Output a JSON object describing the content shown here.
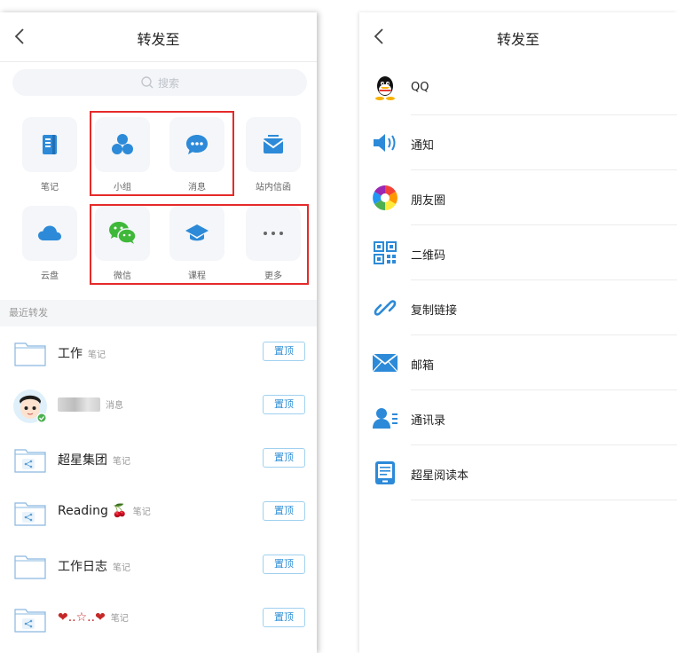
{
  "left": {
    "title": "转发至",
    "search_placeholder": "搜索",
    "tiles": [
      {
        "label": "笔记",
        "icon": "note-icon"
      },
      {
        "label": "小组",
        "icon": "group-icon"
      },
      {
        "label": "消息",
        "icon": "message-icon"
      },
      {
        "label": "站内信函",
        "icon": "letter-icon"
      },
      {
        "label": "云盘",
        "icon": "cloud-icon"
      },
      {
        "label": "微信",
        "icon": "wechat-icon"
      },
      {
        "label": "课程",
        "icon": "course-icon"
      },
      {
        "label": "更多",
        "icon": "more-icon"
      }
    ],
    "recent_header": "最近转发",
    "recent": [
      {
        "name": "工作",
        "type": "笔记",
        "pin": "置顶",
        "icon": "folder-icon"
      },
      {
        "name": "",
        "type": "消息",
        "pin": "置顶",
        "icon": "avatar"
      },
      {
        "name": "超星集团",
        "type": "笔记",
        "pin": "置顶",
        "icon": "shared-folder-icon"
      },
      {
        "name": "Reading 🍒",
        "type": "笔记",
        "pin": "置顶",
        "icon": "shared-folder-icon"
      },
      {
        "name": "工作日志",
        "type": "笔记",
        "pin": "置顶",
        "icon": "folder-icon"
      },
      {
        "name": "❤..☆..❤",
        "type": "笔记",
        "pin": "置顶",
        "icon": "shared-folder-icon"
      }
    ]
  },
  "right": {
    "title": "转发至",
    "items": [
      {
        "label": "QQ",
        "icon": "qq-icon"
      },
      {
        "label": "通知",
        "icon": "speaker-icon"
      },
      {
        "label": "朋友圈",
        "icon": "moments-icon"
      },
      {
        "label": "二维码",
        "icon": "qrcode-icon"
      },
      {
        "label": "复制链接",
        "icon": "link-icon"
      },
      {
        "label": "邮箱",
        "icon": "mail-icon"
      },
      {
        "label": "通讯录",
        "icon": "contacts-icon"
      },
      {
        "label": "超星阅读本",
        "icon": "reader-icon"
      }
    ]
  },
  "colors": {
    "accent": "#2f8fd6",
    "highlight_box": "#e52a2a",
    "wechat_green": "#3fb83a"
  }
}
